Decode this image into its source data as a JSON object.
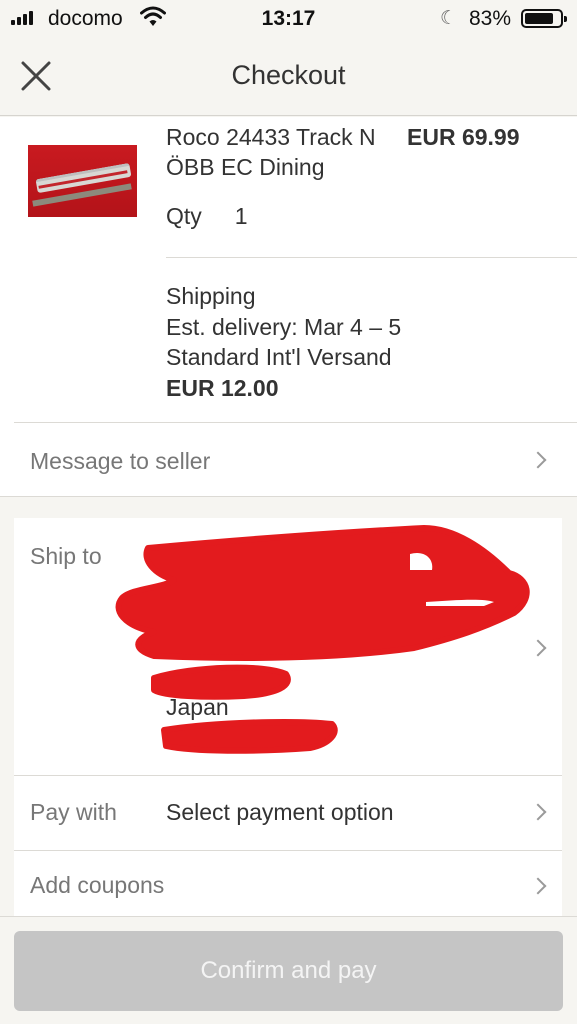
{
  "status_bar": {
    "carrier": "docomo",
    "time": "13:17",
    "battery_percent": "83%",
    "battery_level": 0.83,
    "icons": [
      "signal-icon",
      "wifi-icon",
      "moon-icon",
      "battery-icon"
    ]
  },
  "nav": {
    "title": "Checkout",
    "close_icon": "close-icon"
  },
  "item": {
    "title": "Roco 24433 Track N ÖBB EC Dining",
    "price": "EUR 69.99",
    "qty_label": "Qty",
    "qty_value": "1"
  },
  "shipping": {
    "label": "Shipping",
    "delivery": "Est. delivery: Mar 4 – 5",
    "method": "Standard Int'l Versand",
    "cost": "EUR 12.00"
  },
  "message_row": {
    "label": "Message to seller"
  },
  "ship_to": {
    "label": "Ship to",
    "country": "Japan"
  },
  "pay_row": {
    "label": "Pay with",
    "value": "Select payment option"
  },
  "coupon_row": {
    "label": "Add coupons"
  },
  "confirm": {
    "label": "Confirm and pay"
  },
  "colors": {
    "background": "#f6f5f1",
    "redaction": "#e31b1e",
    "button_disabled": "#c5c5c5"
  }
}
